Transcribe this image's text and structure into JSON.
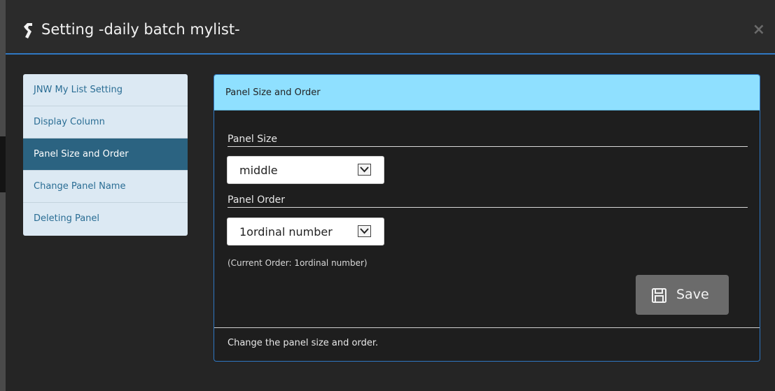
{
  "dialog": {
    "title": "Setting -daily batch mylist-",
    "title_icon": "wrench-icon",
    "close_label": "×"
  },
  "sidebar": {
    "items": [
      {
        "label": "JNW My List Setting",
        "active": false
      },
      {
        "label": "Display Column",
        "active": false
      },
      {
        "label": "Panel Size and Order",
        "active": true
      },
      {
        "label": "Change Panel Name",
        "active": false
      },
      {
        "label": "Deleting Panel",
        "active": false
      }
    ]
  },
  "panel": {
    "header": "Panel Size and Order",
    "panel_size": {
      "label": "Panel Size",
      "value": "middle"
    },
    "panel_order": {
      "label": "Panel Order",
      "value": "1ordinal number"
    },
    "current_order_note": "(Current Order: 1ordinal number)",
    "save_label": "Save",
    "save_icon": "floppy-disk-icon",
    "footer": "Change the panel size and order."
  },
  "colors": {
    "accent_blue": "#2e77c2",
    "panel_header_bg": "#8fe0ff",
    "sidebar_active_bg": "#2b6381",
    "sidebar_bg": "#dce9f3",
    "button_bg": "#6b6b6b"
  }
}
